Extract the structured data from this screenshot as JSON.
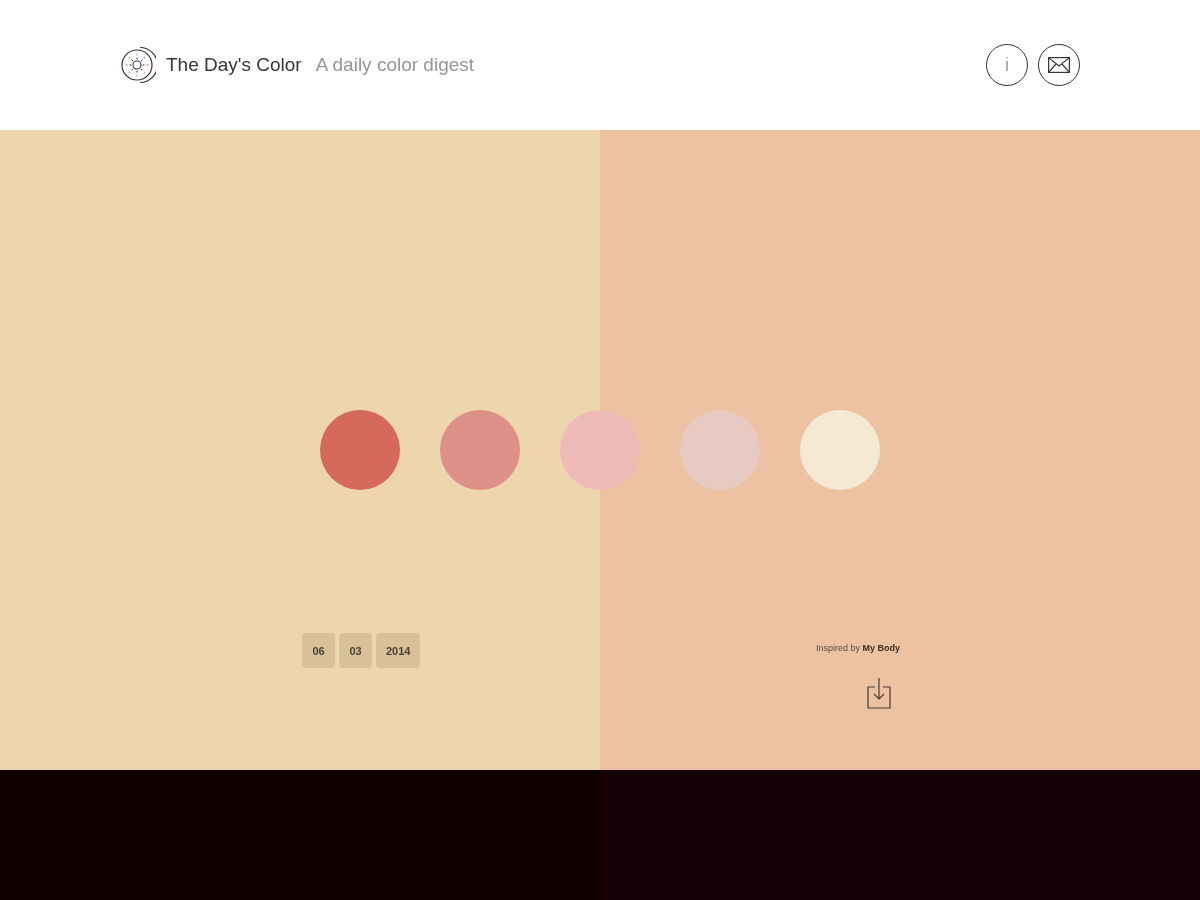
{
  "header": {
    "title": "The Day's Color",
    "tagline": "A daily color digest",
    "buttons": [
      {
        "kind": "info",
        "label": "i"
      },
      {
        "kind": "mail"
      }
    ]
  },
  "panels": [
    {
      "color": "#edd5ad"
    },
    {
      "color": "#edc2a2"
    }
  ],
  "swatches": [
    {
      "color": "#d4695c"
    },
    {
      "color": "#de8f88"
    },
    {
      "color": "#edbab5"
    },
    {
      "color": "#e7cbc3"
    },
    {
      "color": "#f4ead4"
    }
  ],
  "date_parts": [
    "06",
    "03",
    "2014"
  ],
  "inspiration": "Inspired by **My Body**"
}
